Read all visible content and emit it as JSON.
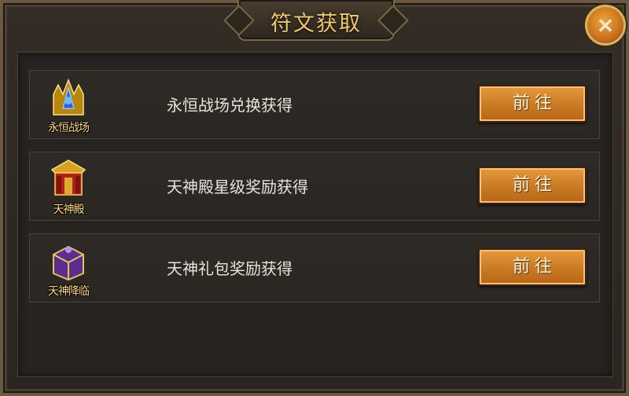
{
  "dialog": {
    "title": "符文获取",
    "close_icon": "×"
  },
  "sources": [
    {
      "icon": "eternal-battlefield-icon",
      "caption": "永恒战场",
      "description": "永恒战场兑换获得",
      "button": "前往"
    },
    {
      "icon": "celestial-palace-icon",
      "caption": "天神殿",
      "description": "天神殿星级奖励获得",
      "button": "前往"
    },
    {
      "icon": "celestial-descent-icon",
      "caption": "天神降临",
      "description": "天神礼包奖励获得",
      "button": "前往"
    }
  ],
  "colors": {
    "title": "#f2c86a",
    "button": "#d68a2e",
    "caption": "#ffde7a"
  }
}
